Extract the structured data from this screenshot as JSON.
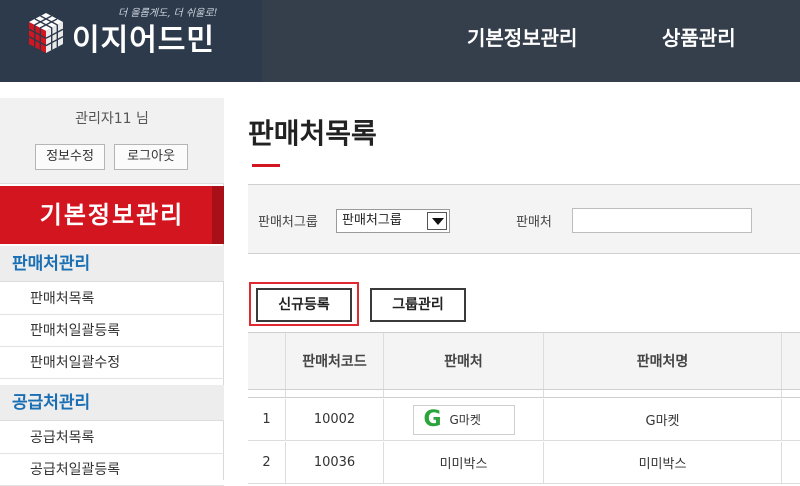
{
  "header": {
    "logo_text": "이지어드민",
    "slogan": "더 올롭게도, 더 쉬울로!",
    "nav": [
      "기본정보관리",
      "상품관리"
    ]
  },
  "sidebar": {
    "user_name": "관리자11 님",
    "info_button": "정보수정",
    "logout_button": "로그아웃",
    "title": "기본정보관리",
    "sections": [
      {
        "label": "판매처관리",
        "items": [
          "판매처목록",
          "판매처일괄등록",
          "판매처일괄수정"
        ]
      },
      {
        "label": "공급처관리",
        "items": [
          "공급처목록",
          "공급처일괄등록"
        ]
      }
    ]
  },
  "main": {
    "page_title": "판매처목록",
    "filters": {
      "group_label": "판매처그룹",
      "group_selected": "판매처그룹",
      "seller_label": "판매처",
      "seller_value": ""
    },
    "buttons": {
      "new": "신규등록",
      "group": "그룹관리"
    },
    "table": {
      "headers": [
        "",
        "판매처코드",
        "판매처",
        "판매처명"
      ],
      "rows": [
        {
          "no": "1",
          "code": "10002",
          "seller": "G마켓",
          "seller_icon": "g-market-icon",
          "name": "G마켓"
        },
        {
          "no": "2",
          "code": "10036",
          "seller": "미미박스",
          "name": "미미박스"
        }
      ]
    }
  },
  "colors": {
    "header_bg": "#353f4c",
    "accent_red": "#d3151f",
    "section_blue": "#1a6fb4",
    "gmarket_green": "#2aa53d"
  }
}
